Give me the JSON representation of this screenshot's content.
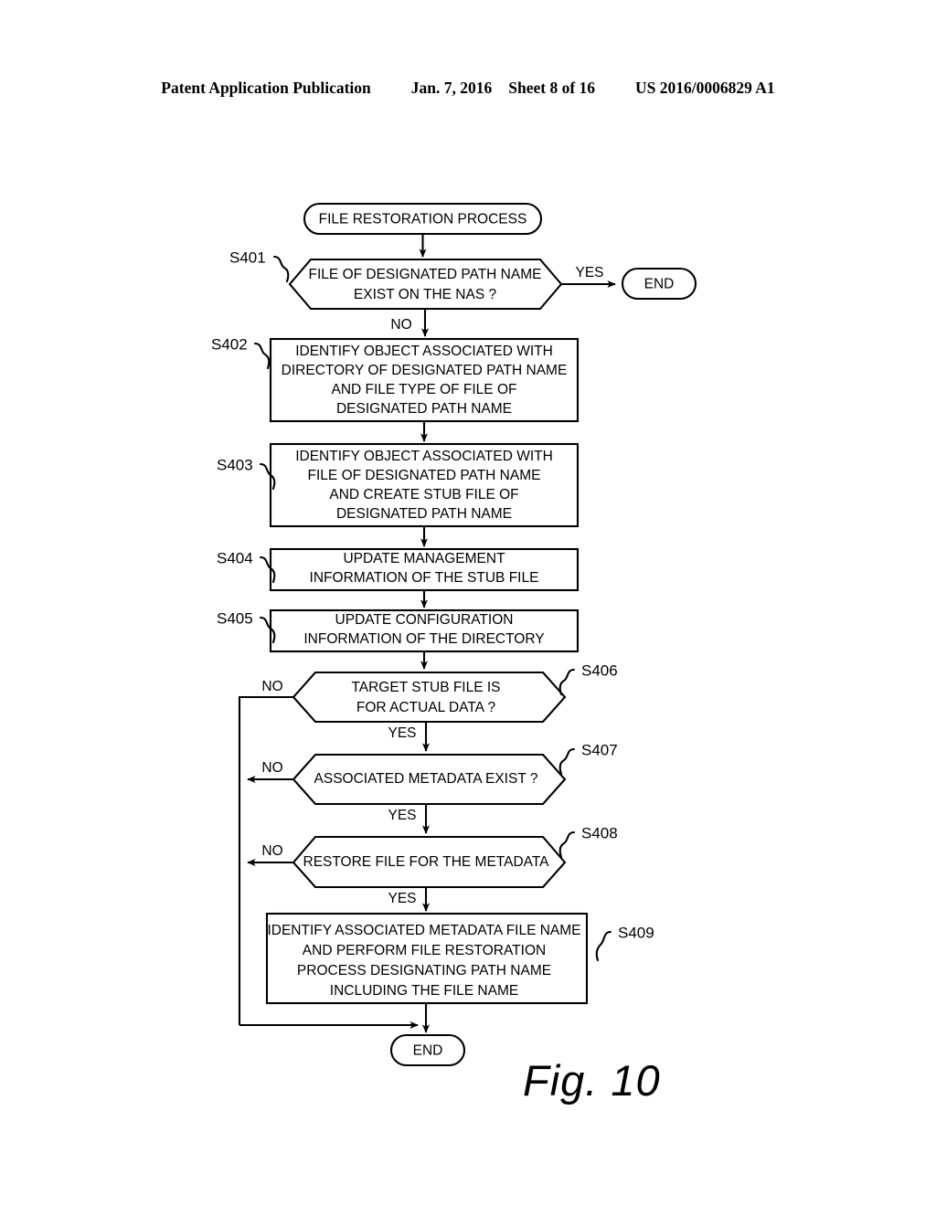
{
  "header": {
    "publication": "Patent Application Publication",
    "date": "Jan. 7, 2016",
    "sheet": "Sheet 8 of 16",
    "patent_number": "US 2016/0006829 A1"
  },
  "figure": {
    "caption": "Fig. 10",
    "title": "FILE RESTORATION PROCESS"
  },
  "flowchart": {
    "start": {
      "label": "FILE RESTORATION PROCESS"
    },
    "end_top": {
      "label": "END"
    },
    "end_bottom": {
      "label": "END"
    },
    "steps": [
      {
        "id": "S401",
        "type": "decision",
        "lines": [
          "FILE OF DESIGNATED PATH NAME",
          "EXIST ON THE NAS ?"
        ],
        "yes": "YES",
        "no": "NO"
      },
      {
        "id": "S402",
        "type": "process",
        "lines": [
          "IDENTIFY OBJECT ASSOCIATED WITH",
          "DIRECTORY OF DESIGNATED PATH NAME",
          "AND FILE TYPE OF FILE OF",
          "DESIGNATED PATH NAME"
        ]
      },
      {
        "id": "S403",
        "type": "process",
        "lines": [
          "IDENTIFY OBJECT ASSOCIATED WITH",
          "FILE OF DESIGNATED PATH NAME",
          "AND CREATE STUB FILE OF",
          "DESIGNATED PATH NAME"
        ]
      },
      {
        "id": "S404",
        "type": "process",
        "lines": [
          "UPDATE MANAGEMENT",
          "INFORMATION OF THE STUB FILE"
        ]
      },
      {
        "id": "S405",
        "type": "process",
        "lines": [
          "UPDATE CONFIGURATION",
          "INFORMATION OF THE DIRECTORY"
        ]
      },
      {
        "id": "S406",
        "type": "decision",
        "lines": [
          "TARGET STUB FILE IS",
          "FOR ACTUAL DATA ?"
        ],
        "yes": "YES",
        "no": "NO"
      },
      {
        "id": "S407",
        "type": "decision",
        "lines": [
          "ASSOCIATED METADATA EXIST ?"
        ],
        "yes": "YES",
        "no": "NO"
      },
      {
        "id": "S408",
        "type": "decision",
        "lines": [
          "RESTORE FILE FOR THE METADATA"
        ],
        "yes": "YES",
        "no": "NO"
      },
      {
        "id": "S409",
        "type": "process",
        "lines": [
          "IDENTIFY ASSOCIATED METADATA FILE NAME",
          "AND PERFORM FILE RESTORATION",
          "PROCESS DESIGNATING PATH NAME",
          "INCLUDING THE FILE NAME"
        ]
      }
    ]
  },
  "colors": {
    "ink": "#000000",
    "paper": "#ffffff"
  }
}
